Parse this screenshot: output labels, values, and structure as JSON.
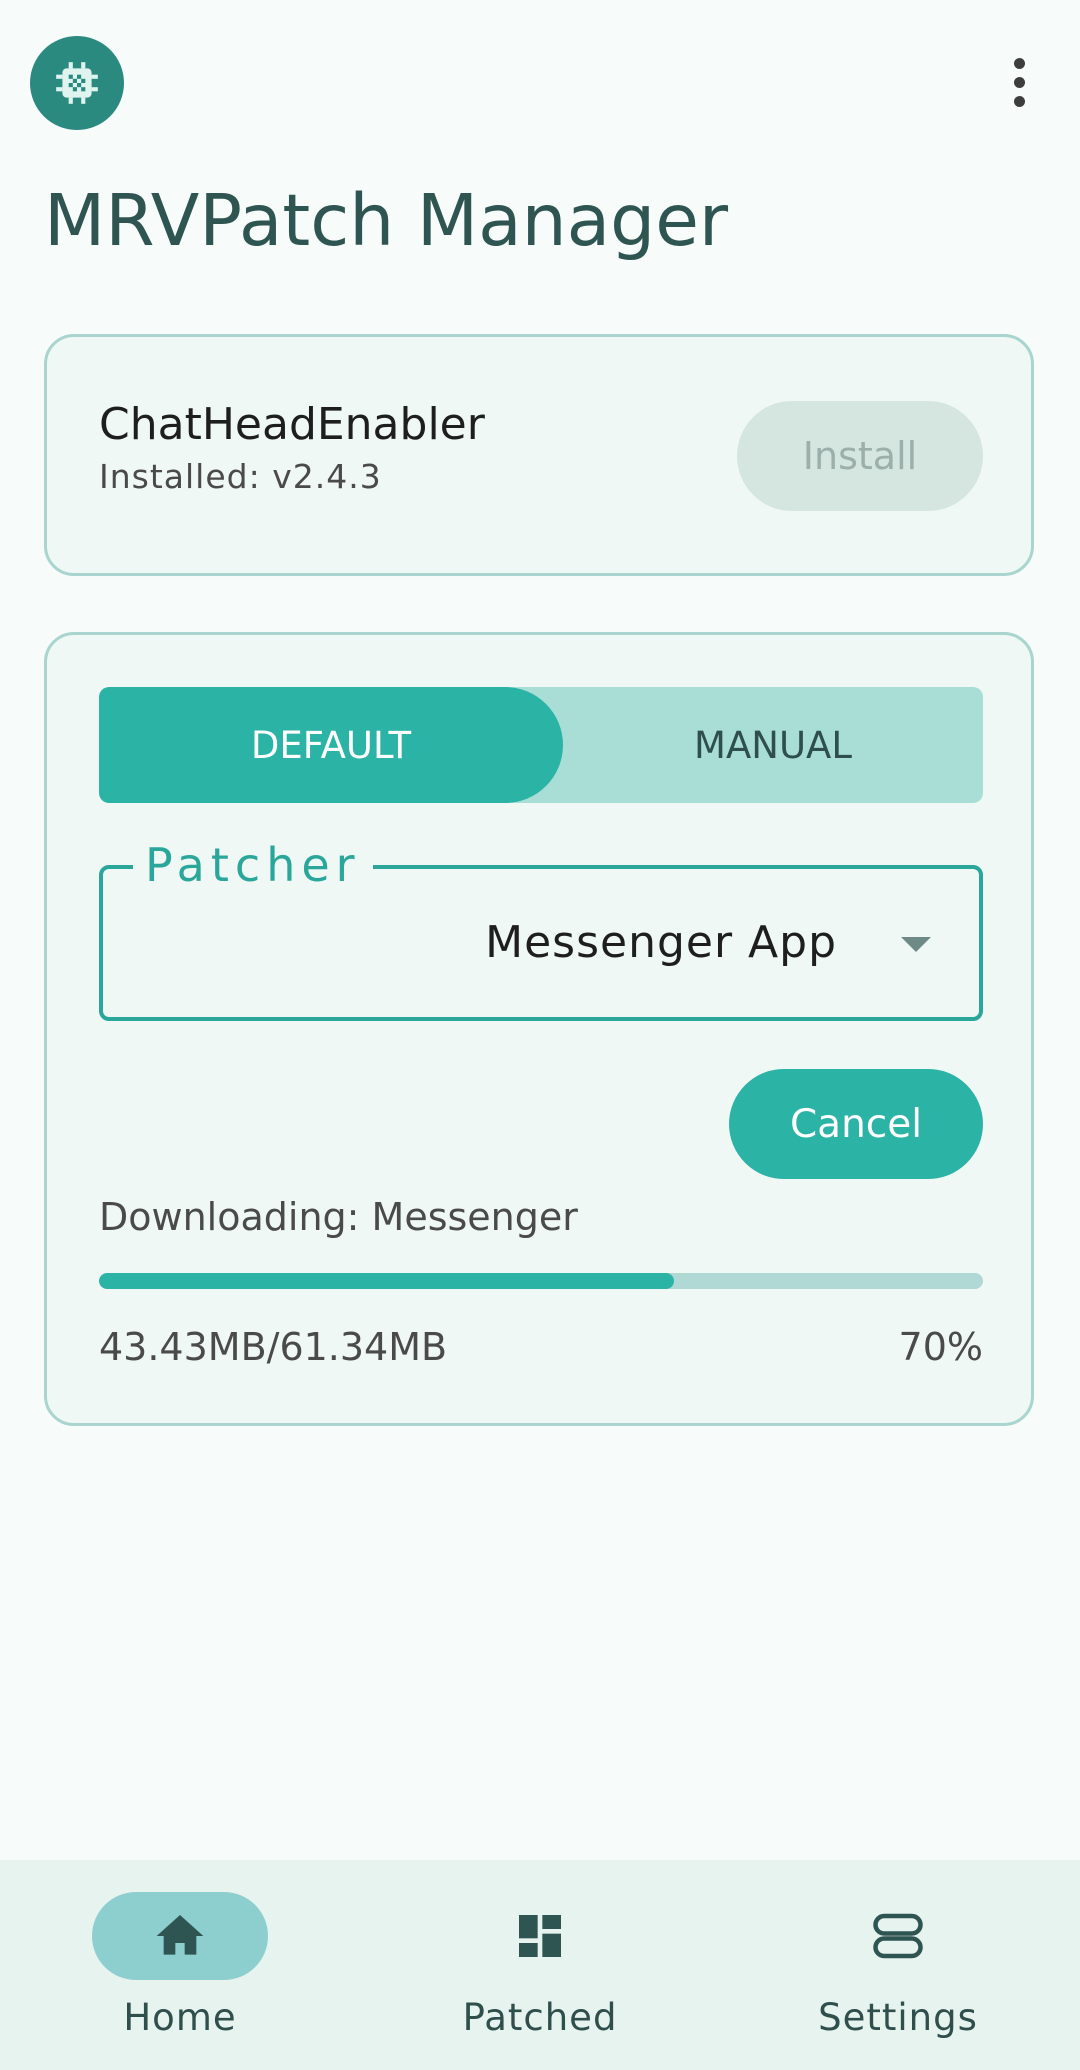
{
  "header": {
    "app_icon": "chip-icon",
    "title": "MRVPatch Manager",
    "menu_icon": "more-vert-icon"
  },
  "installed_card": {
    "patch_name": "ChatHeadEnabler",
    "version": "Installed: v2.4.3",
    "install_label": "Install",
    "install_enabled": false
  },
  "patch_card": {
    "segments": [
      {
        "label": "DEFAULT",
        "selected": true
      },
      {
        "label": "MANUAL",
        "selected": false
      }
    ],
    "patcher": {
      "label": "Patcher",
      "value": "Messenger App",
      "icon": "caret-down-icon"
    },
    "cancel_label": "Cancel",
    "download": {
      "status": "Downloading: Messenger",
      "size": "43.43MB/61.34MB",
      "percent_text": "70%",
      "progress": 0.65
    }
  },
  "bottom_nav": {
    "items": [
      {
        "label": "Home",
        "icon": "home-icon",
        "active": true
      },
      {
        "label": "Patched",
        "icon": "dashboard-icon",
        "active": false
      },
      {
        "label": "Settings",
        "icon": "toggles-icon",
        "active": false
      }
    ]
  },
  "colors": {
    "accent": "#2bb3a5",
    "accent_light": "#a9ded7",
    "title": "#2f5552",
    "card_border": "#a9d4cf",
    "nav_background": "#e6f3ef"
  }
}
